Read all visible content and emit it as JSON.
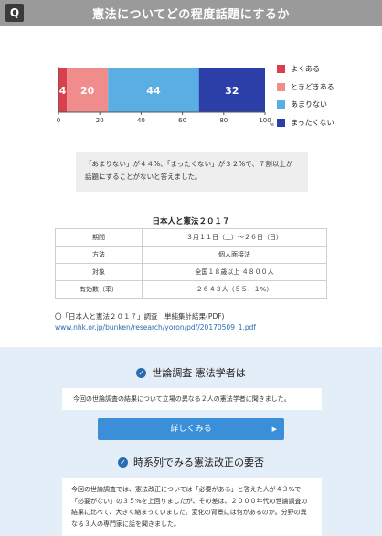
{
  "header": {
    "badge": "Q",
    "title": "憲法についてどの程度話題にするか"
  },
  "chart_data": {
    "type": "bar",
    "orientation": "horizontal-stacked",
    "series": [
      {
        "name": "よくある",
        "value": 4,
        "color": "#d9404b"
      },
      {
        "name": "ときどきある",
        "value": 20,
        "color": "#f08c8c"
      },
      {
        "name": "あまりない",
        "value": 44,
        "color": "#5aaee3"
      },
      {
        "name": "まったくない",
        "value": 32,
        "color": "#2c3fa8"
      }
    ],
    "xticks": [
      "0",
      "20",
      "40",
      "60",
      "80",
      "100"
    ],
    "xunit": "%",
    "xlim": [
      0,
      100
    ],
    "legend": "right"
  },
  "note": {
    "text": "「あまりない」が４４%、「まったくない」が３２%で、７割以上が話題にすることがないと答えました。"
  },
  "survey": {
    "title": "日本人と憲法２０１７",
    "rows": [
      {
        "key": "期間",
        "value": "３月１１日（土）～２６日（日）"
      },
      {
        "key": "方法",
        "value": "個人面接法"
      },
      {
        "key": "対象",
        "value": "全国１８歳以上 ４８００人"
      },
      {
        "key": "有効数（率）",
        "value": "２６４３人（５５．１%）"
      }
    ]
  },
  "link": {
    "title": "〇「日本人と憲法２０１７」調査　単純集計結果(PDF)",
    "url": "www.nhk.or.jp/bunken/research/yoron/pdf/20170509_1.pdf"
  },
  "section1": {
    "heading": "世論調査 憲法学者は",
    "text": "今回の世論調査の結果について立場の異なる２人の憲法学者に聞きました。",
    "button": "詳しくみる"
  },
  "section2": {
    "heading": "時系列でみる憲法改正の要否",
    "text": "今回の世論調査では、憲法改正については「必要がある」と答えた人が４３%で「必要がない」の３５%を上回りましたが、その差は、２０００年代の世論調査の結果に比べて、大きく縮まっていました。変化の背景には何があるのか。分野の異なる３人の専門家に話を聞きました。"
  }
}
